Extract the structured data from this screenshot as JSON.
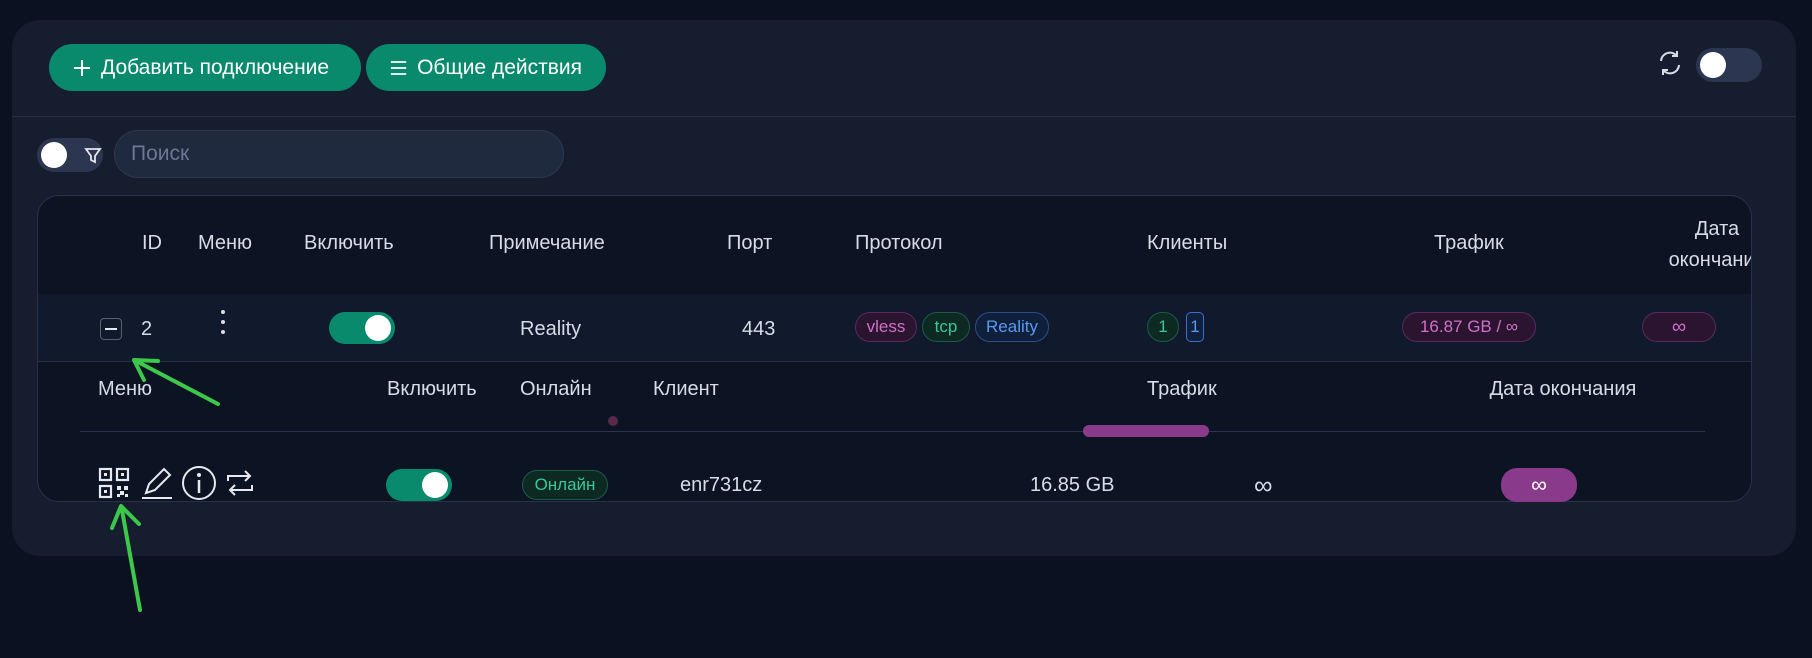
{
  "toolbar": {
    "add_label": "Добавить подключение",
    "common_label": "Общие действия"
  },
  "search": {
    "placeholder": "Поиск"
  },
  "table": {
    "headers": {
      "id": "ID",
      "menu": "Меню",
      "enable": "Включить",
      "note": "Примечание",
      "port": "Порт",
      "protocol": "Протокол",
      "clients": "Клиенты",
      "traffic": "Трафик",
      "expiry_line1": "Дата",
      "expiry_line2": "окончания"
    },
    "row": {
      "id": "2",
      "note": "Reality",
      "port": "443",
      "protocol_tags": [
        "vless",
        "tcp",
        "Reality"
      ],
      "clients_total": "1",
      "clients_online": "1",
      "traffic": "16.87 GB / ∞",
      "expiry": "∞"
    }
  },
  "clients": {
    "headers": {
      "menu": "Меню",
      "enable": "Включить",
      "online": "Онлайн",
      "client": "Клиент",
      "traffic": "Трафик",
      "expiry": "Дата окончания"
    },
    "row": {
      "status": "Онлайн",
      "name": "enr731cz",
      "traffic_used": "16.85 GB",
      "traffic_limit": "∞",
      "expiry": "∞"
    }
  },
  "icons": [
    "plus-icon",
    "menu-icon",
    "refresh-icon",
    "filter-icon",
    "kebab-icon",
    "qrcode-icon",
    "edit-icon",
    "info-icon",
    "repeat-icon"
  ],
  "colors": {
    "accent": "#0a8a6c",
    "background": "#0b1120",
    "card": "#151d2f",
    "magenta": "#8a3a8a",
    "arrow": "#3cc84a"
  }
}
